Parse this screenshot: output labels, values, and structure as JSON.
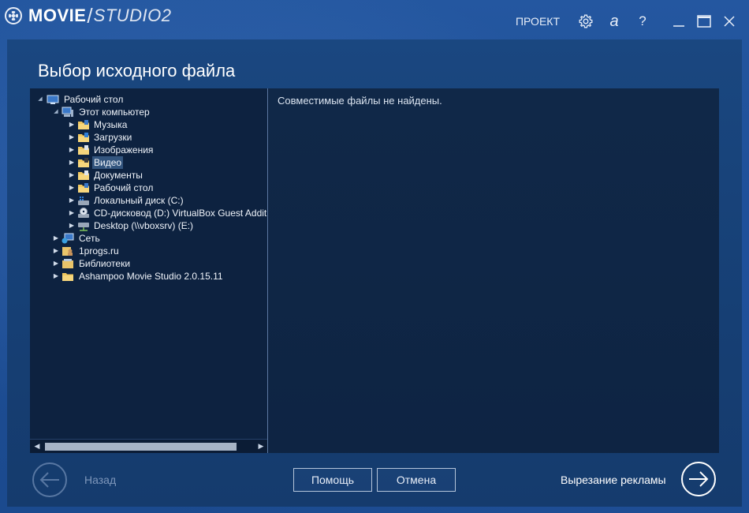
{
  "app": {
    "logo_movie": "MOVIE",
    "logo_slash": "/",
    "logo_studio": "STUDIO2",
    "project_label": "ПРОЕКТ",
    "font_icon_label": "a",
    "help_icon_label": "?"
  },
  "page": {
    "title": "Выбор исходного файла"
  },
  "tree": {
    "items": [
      {
        "label": "Рабочий стол",
        "level": 0,
        "expander": "expanded",
        "icon": "desktop-icon"
      },
      {
        "label": "Этот компьютер",
        "level": 1,
        "expander": "expanded",
        "icon": "computer-icon"
      },
      {
        "label": "Музыка",
        "level": 2,
        "expander": "collapsed",
        "icon": "music-folder-icon"
      },
      {
        "label": "Загрузки",
        "level": 2,
        "expander": "collapsed",
        "icon": "downloads-folder-icon"
      },
      {
        "label": "Изображения",
        "level": 2,
        "expander": "collapsed",
        "icon": "pictures-folder-icon"
      },
      {
        "label": "Видео",
        "level": 2,
        "expander": "collapsed",
        "icon": "video-folder-icon",
        "selected": true
      },
      {
        "label": "Документы",
        "level": 2,
        "expander": "collapsed",
        "icon": "documents-folder-icon"
      },
      {
        "label": "Рабочий стол",
        "level": 2,
        "expander": "collapsed",
        "icon": "desktop-folder-icon"
      },
      {
        "label": "Локальный диск (C:)",
        "level": 2,
        "expander": "collapsed",
        "icon": "local-disk-icon"
      },
      {
        "label": "CD-дисковод (D:) VirtualBox Guest Addit",
        "level": 2,
        "expander": "collapsed",
        "icon": "cd-drive-icon"
      },
      {
        "label": "Desktop (\\\\vboxsrv) (E:)",
        "level": 2,
        "expander": "collapsed",
        "icon": "network-drive-icon"
      },
      {
        "label": "Сеть",
        "level": 1,
        "expander": "collapsed",
        "icon": "network-icon"
      },
      {
        "label": "1progs.ru",
        "level": 1,
        "expander": "collapsed",
        "icon": "user-folder-icon"
      },
      {
        "label": "Библиотеки",
        "level": 1,
        "expander": "collapsed",
        "icon": "libraries-icon"
      },
      {
        "label": "Ashampoo Movie Studio 2.0.15.11",
        "level": 1,
        "expander": "collapsed",
        "icon": "folder-icon"
      }
    ]
  },
  "files": {
    "empty_message": "Совместимые файлы не найдены."
  },
  "footer": {
    "back_label": "Назад",
    "help_label": "Помощь",
    "cancel_label": "Отмена",
    "next_label": "Вырезание рекламы"
  },
  "colors": {
    "background": "#1d4e96",
    "panel": "#163f74",
    "content": "#0e2342",
    "selection": "#33557e",
    "accent": "#ffffff",
    "disabled": "#7e97bb"
  }
}
